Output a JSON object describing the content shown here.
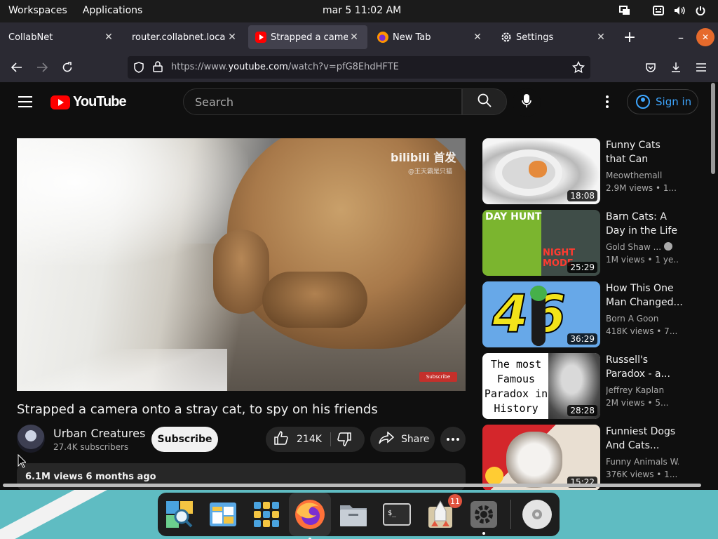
{
  "topbar": {
    "workspaces": "Workspaces",
    "applications": "Applications",
    "clock": "mar 5  11:02 AM"
  },
  "tabs": [
    {
      "title": "CollabNet"
    },
    {
      "title": "router.collabnet.local/"
    },
    {
      "title": "Strapped a camera"
    },
    {
      "title": "New Tab"
    },
    {
      "title": "Settings"
    }
  ],
  "urlbar": {
    "url_prefix": "https://www.",
    "url_host": "youtube.com",
    "url_path": "/watch?v=pfG8EhdHFTE"
  },
  "youtube": {
    "logo_text": "YouTube",
    "search_placeholder": "Search",
    "sign_in": "Sign in",
    "video": {
      "watermark": "bilibili 首发",
      "watermark_sub": "@王天霸是只猫",
      "overlay_subscribe": "Subscribe",
      "title": "Strapped a camera onto a stray cat, to spy on his friends",
      "channel": "Urban Creatures",
      "subscribers": "27.4K subscribers",
      "subscribe_label": "Subscribe",
      "likes": "214K",
      "share_label": "Share",
      "views_date": "6.1M views  6 months ago"
    },
    "recommendations": [
      {
        "title": "Funny Cats that Can Probably...",
        "channel": "Meowthemall",
        "meta": "2.9M views  • 1...",
        "duration": "18:08"
      },
      {
        "title": "Barn Cats: A Day in the Life",
        "channel": "Gold Shaw ...",
        "meta": "1M views  • 1 ye...",
        "duration": "25:29",
        "thumb_text_1": "DAY HUNT",
        "thumb_text_2": "NIGHT MODE"
      },
      {
        "title": "How This One Man Changed...",
        "channel": "Born A Goon",
        "meta": "418K views  • 7...",
        "duration": "36:29",
        "thumb_text": "46"
      },
      {
        "title": "Russell's Paradox - a...",
        "channel": "Jeffrey Kaplan",
        "meta": "2M views  • 5...",
        "duration": "28:28",
        "thumb_text": "The most Famous Paradox in History"
      },
      {
        "title": "Funniest Dogs And Cats...",
        "channel": "Funny Animals W...",
        "meta": "376K views  • 1...",
        "duration": "15:22"
      }
    ]
  },
  "dock": {
    "launcher_badge": "11"
  }
}
